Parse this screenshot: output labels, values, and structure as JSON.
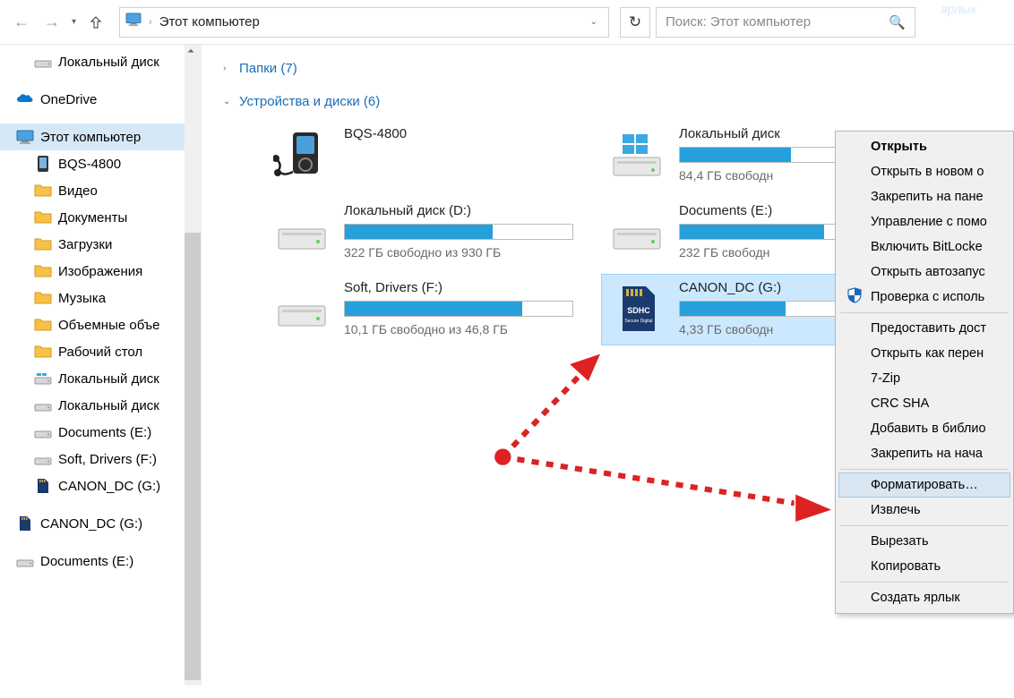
{
  "toolbar": {
    "location_label": "Этот компьютер",
    "search_placeholder": "Поиск: Этот компьютер"
  },
  "sidebar": [
    {
      "icon": "drive",
      "label": "Локальный диск",
      "indent": 1
    },
    {
      "icon": "spacer"
    },
    {
      "icon": "onedrive",
      "label": "OneDrive",
      "indent": 0
    },
    {
      "icon": "spacer"
    },
    {
      "icon": "pc",
      "label": "Этот компьютер",
      "indent": 0,
      "selected": true
    },
    {
      "icon": "phone",
      "label": "BQS-4800",
      "indent": 1
    },
    {
      "icon": "folder-video",
      "label": "Видео",
      "indent": 1
    },
    {
      "icon": "folder-doc",
      "label": "Документы",
      "indent": 1
    },
    {
      "icon": "folder-dl",
      "label": "Загрузки",
      "indent": 1
    },
    {
      "icon": "folder-img",
      "label": "Изображения",
      "indent": 1
    },
    {
      "icon": "folder-music",
      "label": "Музыка",
      "indent": 1
    },
    {
      "icon": "folder-3d",
      "label": "Объемные объе",
      "indent": 1
    },
    {
      "icon": "folder-desktop",
      "label": "Рабочий стол",
      "indent": 1
    },
    {
      "icon": "drive-win",
      "label": "Локальный диск",
      "indent": 1
    },
    {
      "icon": "drive",
      "label": "Локальный диск",
      "indent": 1
    },
    {
      "icon": "drive",
      "label": "Documents (E:)",
      "indent": 1
    },
    {
      "icon": "drive",
      "label": "Soft, Drivers (F:)",
      "indent": 1
    },
    {
      "icon": "sd",
      "label": "CANON_DC (G:)",
      "indent": 1
    },
    {
      "icon": "spacer"
    },
    {
      "icon": "sd",
      "label": "CANON_DC (G:)",
      "indent": 0
    },
    {
      "icon": "spacer"
    },
    {
      "icon": "drive",
      "label": "Documents (E:)",
      "indent": 0
    }
  ],
  "groups": {
    "folders": {
      "label": "Папки (7)",
      "expanded": false
    },
    "devices": {
      "label": "Устройства и диски (6)",
      "expanded": true
    }
  },
  "drives": [
    {
      "type": "player",
      "name": "BQS-4800",
      "fill": 0,
      "free": ""
    },
    {
      "type": "win",
      "name": "Локальный диск",
      "fill": 0.58,
      "free": "84,4 ГБ свободн"
    },
    {
      "type": "hdd",
      "name": "Локальный диск (D:)",
      "fill": 0.65,
      "free": "322 ГБ свободно из 930 ГБ"
    },
    {
      "type": "hdd",
      "name": "Documents (E:)",
      "fill": 0.75,
      "free": "232 ГБ свободн"
    },
    {
      "type": "hdd",
      "name": "Soft, Drivers (F:)",
      "fill": 0.78,
      "free": "10,1 ГБ свободно из 46,8 ГБ"
    },
    {
      "type": "sd",
      "name": "CANON_DC (G:)",
      "fill": 0.55,
      "free": "4,33 ГБ свободн",
      "selected": true
    }
  ],
  "context_menu": [
    {
      "label": "Открыть",
      "bold": true
    },
    {
      "label": "Открыть в новом о"
    },
    {
      "label": "Закрепить на пане"
    },
    {
      "label": "Управление с помо"
    },
    {
      "label": "Включить BitLocke"
    },
    {
      "label": "Открыть автозапус"
    },
    {
      "label": "Проверка с исполь",
      "icon": "shield"
    },
    {
      "sep": true
    },
    {
      "label": "Предоставить дост"
    },
    {
      "label": "Открыть как перен"
    },
    {
      "label": "7-Zip"
    },
    {
      "label": "CRC SHA"
    },
    {
      "label": "Добавить в библио"
    },
    {
      "label": "Закрепить на нача"
    },
    {
      "sep": true
    },
    {
      "label": "Форматировать…",
      "hover": true
    },
    {
      "label": "Извлечь"
    },
    {
      "sep": true
    },
    {
      "label": "Вырезать"
    },
    {
      "label": "Копировать"
    },
    {
      "sep": true
    },
    {
      "label": "Создать ярлык"
    }
  ],
  "shortcut_label": "ярлык"
}
